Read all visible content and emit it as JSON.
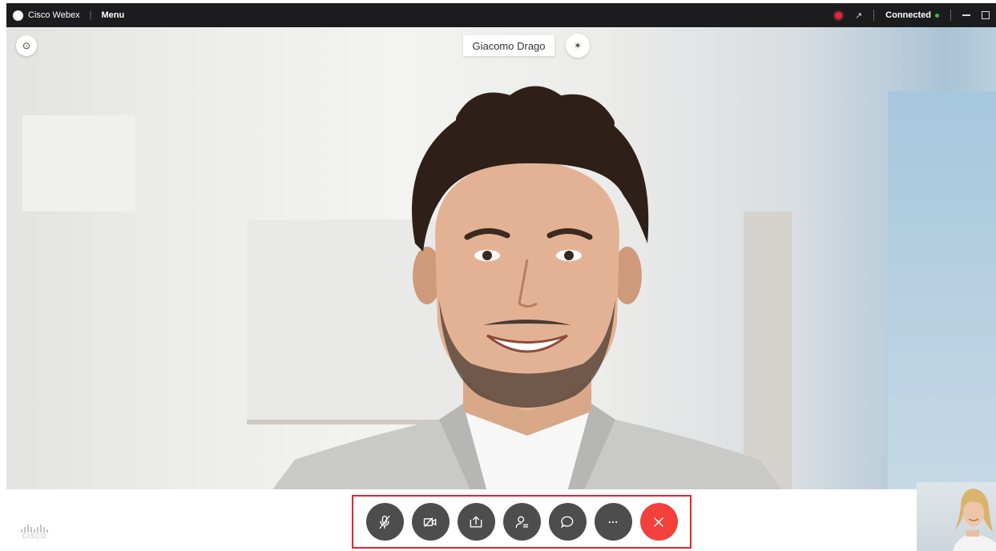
{
  "titlebar": {
    "app_name": "Cisco Webex",
    "separator": "|",
    "menu_label": "Menu",
    "status": "Connected",
    "status_color": "#3fbf3f"
  },
  "video": {
    "participant_name": "Giacomo Drago"
  },
  "brand": {
    "logo_text": "CISCO"
  },
  "controls": [
    {
      "name": "mute",
      "icon": "microphone-muted-icon"
    },
    {
      "name": "video",
      "icon": "video-off-icon"
    },
    {
      "name": "share",
      "icon": "share-screen-icon"
    },
    {
      "name": "participants",
      "icon": "participants-icon"
    },
    {
      "name": "chat",
      "icon": "chat-icon"
    },
    {
      "name": "more",
      "icon": "more-icon"
    },
    {
      "name": "end-call",
      "icon": "close-icon"
    }
  ],
  "colors": {
    "titlebar_bg": "#1c1c1e",
    "control_bg": "#4d4d4d",
    "end_call": "#f2403b",
    "highlight_border": "#e8222f",
    "recording": "#e0283d"
  }
}
